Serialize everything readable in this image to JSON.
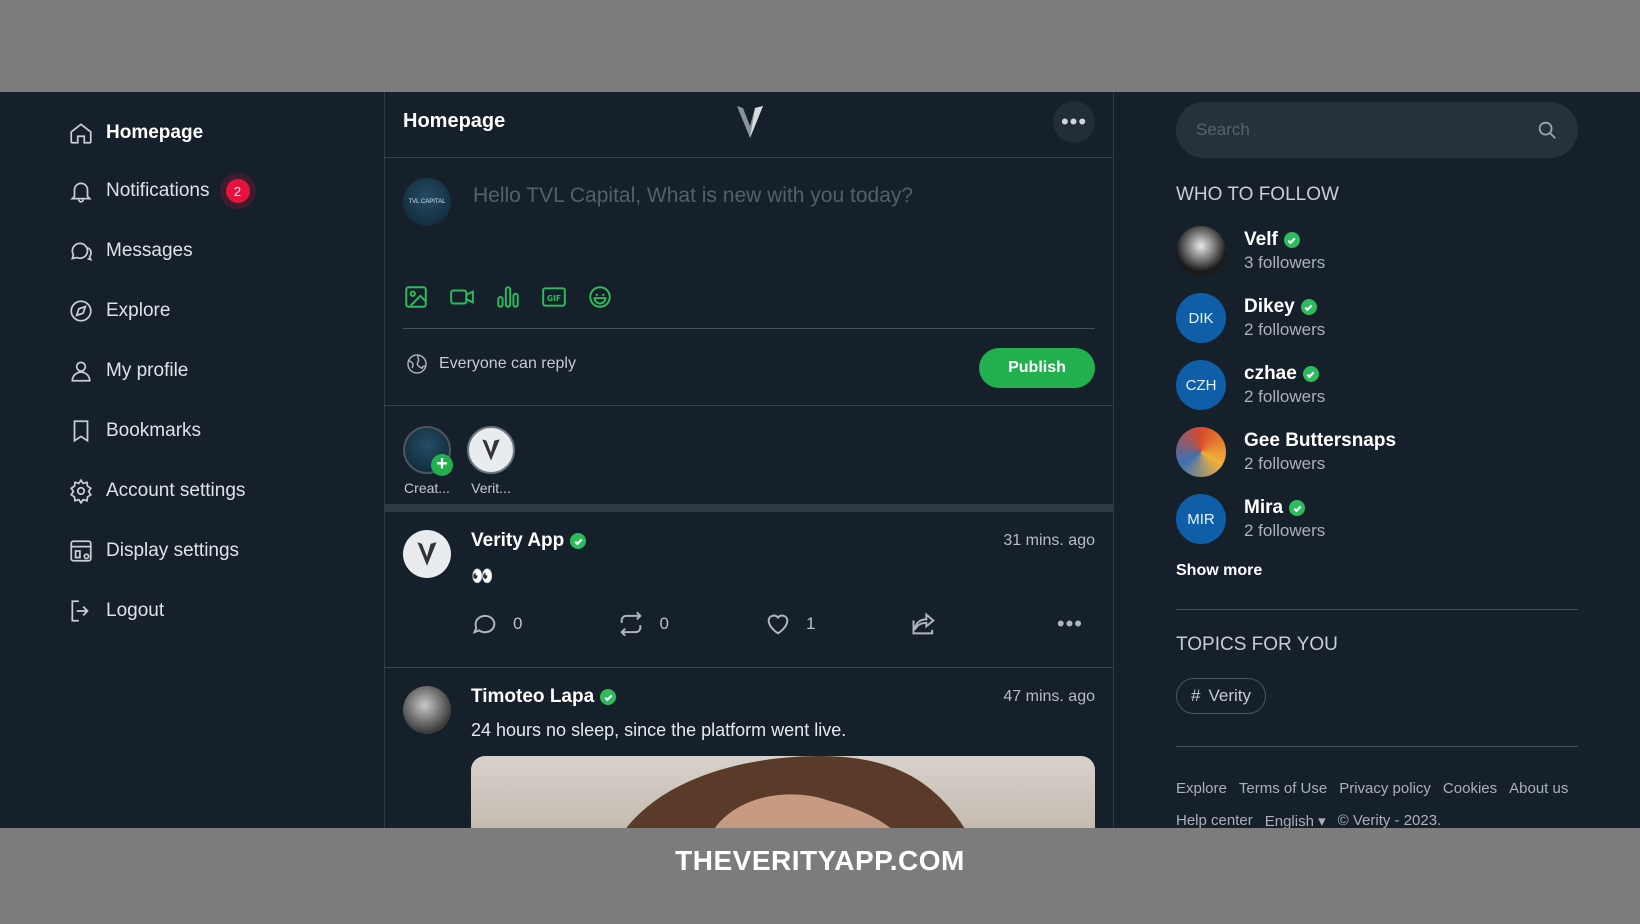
{
  "sidebar": {
    "items": [
      {
        "label": "Homepage",
        "icon": "home-icon"
      },
      {
        "label": "Notifications",
        "icon": "bell-icon",
        "badge": "2"
      },
      {
        "label": "Messages",
        "icon": "chat-icon"
      },
      {
        "label": "Explore",
        "icon": "compass-icon"
      },
      {
        "label": "My profile",
        "icon": "user-icon"
      },
      {
        "label": "Bookmarks",
        "icon": "bookmark-icon"
      },
      {
        "label": "Account settings",
        "icon": "gear-icon"
      },
      {
        "label": "Display settings",
        "icon": "display-settings-icon"
      },
      {
        "label": "Logout",
        "icon": "logout-icon"
      }
    ]
  },
  "header": {
    "title": "Homepage",
    "logo": "V"
  },
  "composer": {
    "placeholder": "Hello TVL Capital, What is new with you today?",
    "avatar_text": "TVL CAPITAL",
    "reply_setting": "Everyone can reply",
    "publish_label": "Publish"
  },
  "stories": [
    {
      "label": "Creat..."
    },
    {
      "label": "Verit..."
    }
  ],
  "posts": [
    {
      "author": "Verity App",
      "time": "31 mins. ago",
      "body": "👀",
      "comments": "0",
      "reposts": "0",
      "likes": "1"
    },
    {
      "author": "Timoteo Lapa",
      "time": "47 mins. ago",
      "body": "24 hours no sleep, since the platform went live."
    }
  ],
  "right": {
    "search_placeholder": "Search",
    "who_to_follow_title": "WHO TO FOLLOW",
    "follow": [
      {
        "name": "Velf",
        "followers": "3 followers",
        "initials": ""
      },
      {
        "name": "Dikey",
        "followers": "2 followers",
        "initials": "DIK"
      },
      {
        "name": "czhae",
        "followers": "2 followers",
        "initials": "CZH"
      },
      {
        "name": "Gee Buttersnaps",
        "followers": "2 followers",
        "initials": ""
      },
      {
        "name": "Mira",
        "followers": "2 followers",
        "initials": "MIR"
      }
    ],
    "show_more": "Show more",
    "topics_title": "TOPICS FOR YOU",
    "topic": "Verity",
    "links_row1": [
      "Explore",
      "Terms of Use",
      "Privacy policy",
      "Cookies",
      "About us"
    ],
    "links_row2": [
      "Help center",
      "English ▾",
      "© Verity - 2023."
    ]
  },
  "banner": "THEVERITYAPP.COM",
  "colors": {
    "accent": "#22b04e",
    "badge": "#e8123f",
    "background": "#16202a",
    "avatar_blue": "#0f5fa8"
  }
}
